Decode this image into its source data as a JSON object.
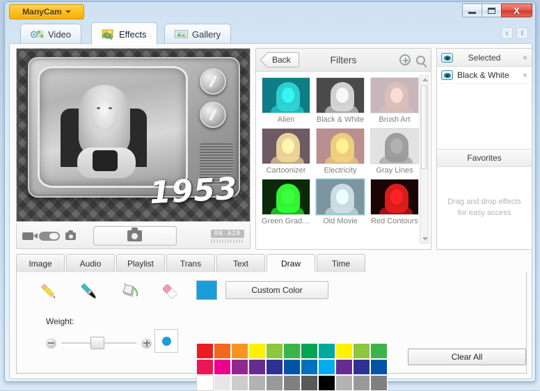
{
  "window": {
    "app_name": "ManyCam",
    "minimize_label": "Minimize",
    "maximize_label": "Maximize",
    "close_label": "X"
  },
  "top_tabs": [
    {
      "label": "Video",
      "icon": "video-icon",
      "active": false
    },
    {
      "label": "Effects",
      "icon": "effects-icon",
      "active": true
    },
    {
      "label": "Gallery",
      "icon": "gallery-icon",
      "active": false
    }
  ],
  "social": [
    {
      "name": "twitter-icon",
      "glyph": "t"
    },
    {
      "name": "facebook-icon",
      "glyph": "f"
    }
  ],
  "preview": {
    "overlay_text": "1953",
    "on_air_label": "ON AIR",
    "snapshot_label": "snapshot-button",
    "mode_toggle_label": "video-photo-toggle"
  },
  "filters_panel": {
    "back_label": "Back",
    "title": "Filters",
    "add_icon": "add-circle-icon",
    "search_icon": "search-icon",
    "items": [
      {
        "label": "Alien",
        "selected": false,
        "tint": "#2fd5d5",
        "bg": "#0e7e84"
      },
      {
        "label": "Black & White",
        "selected": false,
        "tint": "#d8d8d8",
        "bg": "#4a4a4a"
      },
      {
        "label": "Brush Art",
        "selected": false,
        "tint": "#d9c0b8",
        "bg": "#c9b6bd"
      },
      {
        "label": "Cartoonizer",
        "selected": false,
        "tint": "#f0d79a",
        "bg": "#6d5a62"
      },
      {
        "label": "Electricity",
        "selected": false,
        "tint": "#efd27e",
        "bg": "#b98f90"
      },
      {
        "label": "Gray Lines",
        "selected": false,
        "tint": "#9a9a9a",
        "bg": "#e2e2e2"
      },
      {
        "label": "Green Gradi…",
        "selected": false,
        "tint": "#36ff36",
        "bg": "#0a2a0a"
      },
      {
        "label": "Old Movie",
        "selected": true,
        "tint": "#cfdfe6",
        "bg": "#7e949e"
      },
      {
        "label": "Red Contours",
        "selected": false,
        "tint": "#e01f1f",
        "bg": "#1a0505"
      }
    ]
  },
  "selected_panel": {
    "title": "Selected",
    "close_glyph": "×",
    "items": [
      {
        "label": "Black & White"
      }
    ]
  },
  "favorites_panel": {
    "title": "Favorites",
    "empty_line1": "Drag and drop effects",
    "empty_line2": "for easy access"
  },
  "bottom_tabs": [
    {
      "label": "Image",
      "active": false
    },
    {
      "label": "Audio",
      "active": false
    },
    {
      "label": "Playlist",
      "active": false
    },
    {
      "label": "Trans",
      "active": false
    },
    {
      "label": "Text",
      "active": false
    },
    {
      "label": "Draw",
      "active": true
    },
    {
      "label": "Time",
      "active": false
    }
  ],
  "draw_panel": {
    "tools": [
      {
        "name": "pencil-tool",
        "label": "Pencil"
      },
      {
        "name": "brush-tool",
        "label": "Brush"
      },
      {
        "name": "fill-tool",
        "label": "Paint Bucket"
      },
      {
        "name": "eraser-tool",
        "label": "Eraser"
      }
    ],
    "weight_label": "Weight:",
    "weight_minus": "−",
    "weight_plus": "+",
    "custom_color_label": "Custom Color",
    "current_color": "#1a9ed9",
    "clear_all_label": "Clear All",
    "swatches": [
      "#ec1c24",
      "#f26722",
      "#f7941e",
      "#fff200",
      "#8dc63f",
      "#39b54a",
      "#00a651",
      "#00a99d",
      "#fff200",
      "#8dc63f",
      "#39b54a",
      "#ec1555",
      "#ec008c",
      "#92278f",
      "#662d91",
      "#2e3192",
      "#0054a6",
      "#0072bc",
      "#00aeef",
      "#662d91",
      "#2e3192",
      "#0054a6",
      "#ffffff",
      "#e6e6e6",
      "#cccccc",
      "#b3b3b3",
      "#999999",
      "#808080",
      "#595959",
      "#000000",
      "#b3b3b3",
      "#999999",
      "#808080"
    ]
  }
}
